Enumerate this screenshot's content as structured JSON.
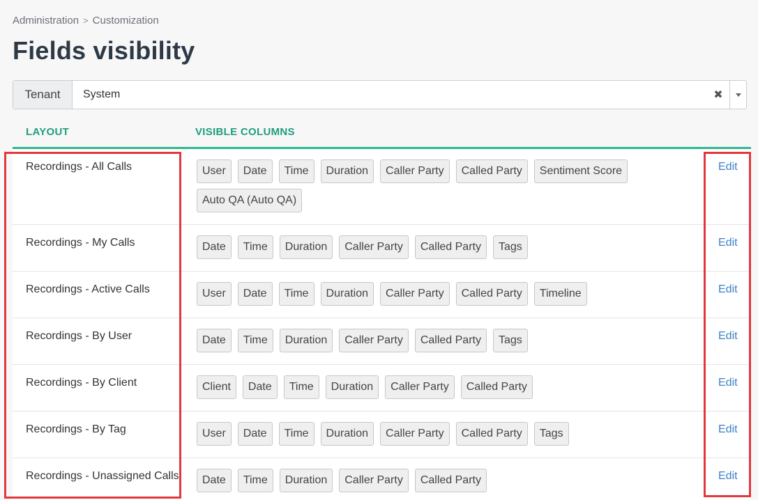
{
  "breadcrumb": {
    "items": [
      "Administration",
      "Customization"
    ],
    "separator": ">"
  },
  "page": {
    "title": "Fields visibility"
  },
  "tenant": {
    "label": "Tenant",
    "value": "System",
    "clear": "✖"
  },
  "table": {
    "headers": {
      "layout": "LAYOUT",
      "columns": "VISIBLE COLUMNS"
    },
    "edit_label": "Edit",
    "rows": [
      {
        "layout": "Recordings - All Calls",
        "columns": [
          "User",
          "Date",
          "Time",
          "Duration",
          "Caller Party",
          "Called Party",
          "Sentiment Score",
          "Auto QA (Auto QA)"
        ]
      },
      {
        "layout": "Recordings - My Calls",
        "columns": [
          "Date",
          "Time",
          "Duration",
          "Caller Party",
          "Called Party",
          "Tags"
        ]
      },
      {
        "layout": "Recordings - Active Calls",
        "columns": [
          "User",
          "Date",
          "Time",
          "Duration",
          "Caller Party",
          "Called Party",
          "Timeline"
        ]
      },
      {
        "layout": "Recordings - By User",
        "columns": [
          "Date",
          "Time",
          "Duration",
          "Caller Party",
          "Called Party",
          "Tags"
        ]
      },
      {
        "layout": "Recordings - By Client",
        "columns": [
          "Client",
          "Date",
          "Time",
          "Duration",
          "Caller Party",
          "Called Party"
        ]
      },
      {
        "layout": "Recordings - By Tag",
        "columns": [
          "User",
          "Date",
          "Time",
          "Duration",
          "Caller Party",
          "Called Party",
          "Tags"
        ]
      },
      {
        "layout": "Recordings - Unassigned Calls",
        "columns": [
          "Date",
          "Time",
          "Duration",
          "Caller Party",
          "Called Party"
        ]
      }
    ]
  },
  "colors": {
    "accent": "#2db891",
    "header_text": "#1f9e7e",
    "link": "#3b7fc4",
    "highlight": "#e3373d"
  }
}
